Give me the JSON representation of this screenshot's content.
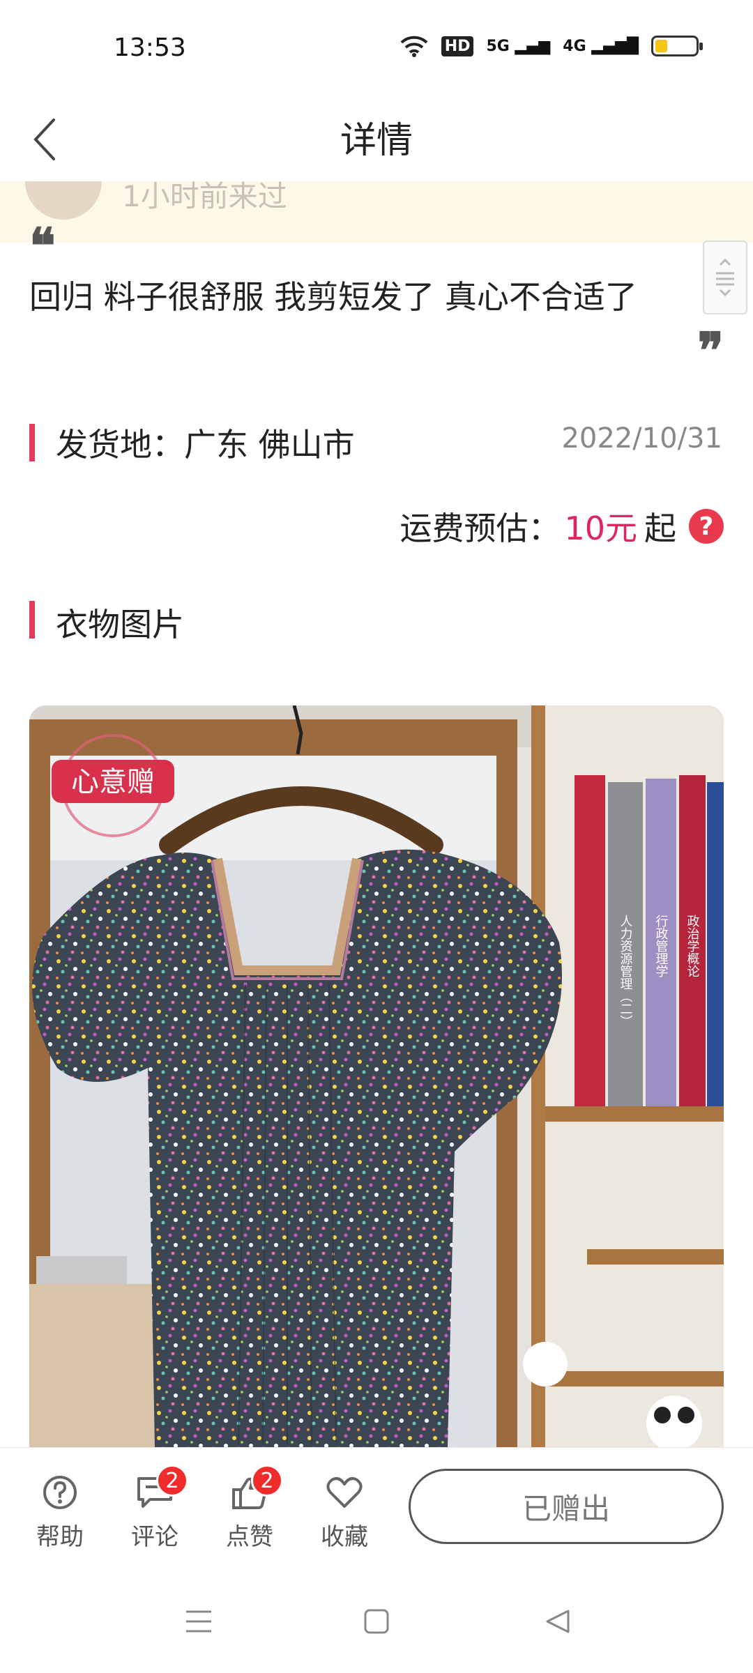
{
  "status_bar": {
    "time": "13:53",
    "wifi_icon": "wifi-icon",
    "hd_label": "HD",
    "net1": "5G",
    "net2": "4G",
    "battery_level": 0.3
  },
  "nav": {
    "title": "详情",
    "back_icon": "chevron-left-icon"
  },
  "banner": {
    "faded_text": "1小时前来过"
  },
  "comment": {
    "text": "回归 料子很舒服 我剪短发了 真心不合适了"
  },
  "shipping": {
    "label": "发货地：广东 佛山市",
    "date": "2022/10/31",
    "fee_label": "运费预估：",
    "fee_amount": "10元",
    "fee_suffix": "起",
    "help_mark": "?"
  },
  "photos": {
    "title": "衣物图片",
    "stamp_text": "心意赠",
    "book_titles": [
      "人力资源管理（二）",
      "行政管理学",
      "政治学概论"
    ]
  },
  "bottom_bar": {
    "help_label": "帮助",
    "comment_label": "评论",
    "comment_count": "2",
    "like_label": "点赞",
    "like_count": "2",
    "favorite_label": "收藏",
    "given_label": "已赠出"
  },
  "colors": {
    "accent": "#e23b5c",
    "price": "#e0245e",
    "badge": "#ef2b2b",
    "banner_bg": "#fdf8e8"
  }
}
